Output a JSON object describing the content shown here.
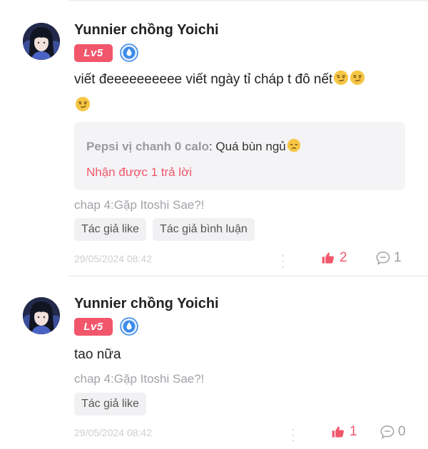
{
  "comments": [
    {
      "username": "Yunnier chồng Yoichi",
      "level": "Lv5",
      "text": "viết đeeeeeeeeee viết ngày tỉ cháp t đô nết",
      "reply": {
        "author": "Pepsi vị chanh 0 calo",
        "separator": ": ",
        "text": "Quá bùn ngủ",
        "count_label": "Nhận được 1 trả lời"
      },
      "chapter": "chap 4:Gặp Itoshi Sae?!",
      "tags": [
        "Tác giả like",
        "Tác giả bình luận"
      ],
      "timestamp": "29/05/2024 08:42",
      "likes": "2",
      "replies": "1"
    },
    {
      "username": "Yunnier chồng Yoichi",
      "level": "Lv5",
      "text": "tao nữa",
      "chapter": "chap 4:Gặp Itoshi Sae?!",
      "tags": [
        "Tác giả like"
      ],
      "timestamp": "29/05/2024 08:42",
      "likes": "1",
      "replies": "0"
    }
  ],
  "icons": {
    "verify": "blue-drop-badge-icon",
    "like": "thumbs-up-icon",
    "reply": "speech-bubble-icon",
    "more": "vertical-dots-icon",
    "emoji_smirk": "smirking-face-emoji",
    "emoji_sad": "disappointed-face-emoji"
  },
  "colors": {
    "accent": "#f2566b",
    "verify": "#3d8be8",
    "muted": "#a2a2a8"
  }
}
